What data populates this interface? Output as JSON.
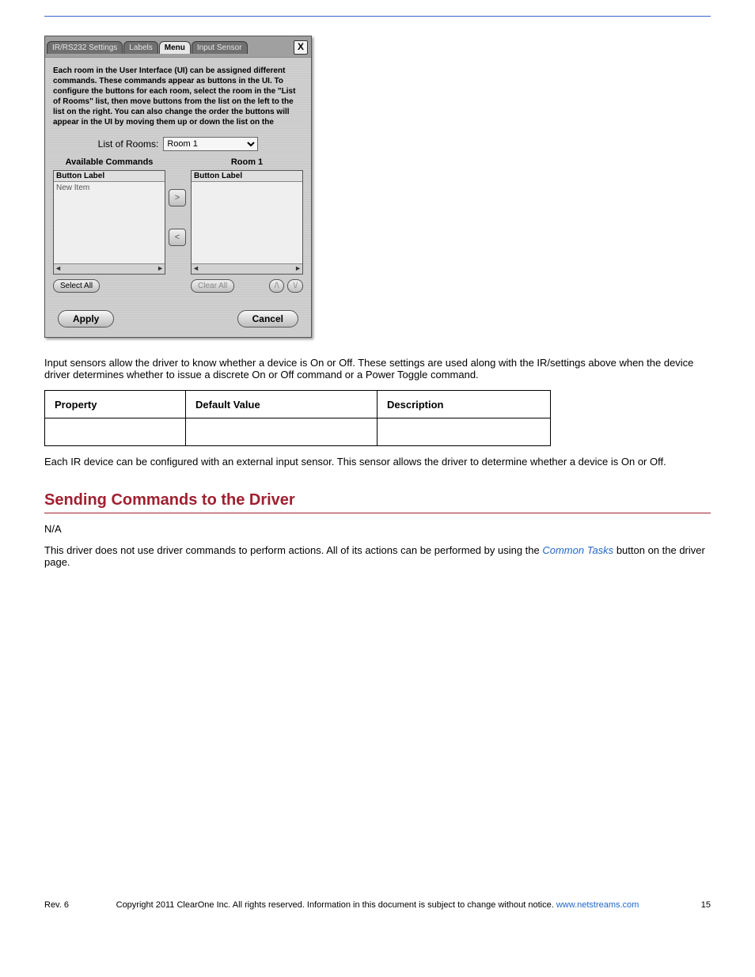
{
  "dialog": {
    "tabs": {
      "ir_rs232": "IR/RS232 Settings",
      "labels": "Labels",
      "menu": "Menu",
      "input_sensor": "Input Sensor"
    },
    "close_x": "X",
    "desc_bold": "Each room in the User Interface (UI) can be assigned different commands.  These commands appear as buttons in the UI.  To configure the buttons for each room, select the room in the \"List of Rooms\" list, then move buttons from the list on the left to the list on the right.  You can also change the order the buttons will appear in the UI by moving them up or down the list on the",
    "rooms_label": "List of Rooms:",
    "rooms_value": "Room 1",
    "avail_hdr": "Available Commands",
    "room_hdr": "Room 1",
    "btn_label_col": "Button Label",
    "sample_item": "New Item",
    "move_right": ">",
    "move_left": "<",
    "select_all": "Select All",
    "clear_all": "Clear All",
    "up": "/\\",
    "down": "\\/",
    "scroll_left": "◄",
    "scroll_right": "►",
    "apply": "Apply",
    "cancel": "Cancel"
  },
  "body": {
    "para_above_spec": "Input sensors allow the driver to know whether a device is On or Off. These settings are used along with the IR/settings above when the device driver determines whether to issue a discrete On or Off command or a Power Toggle command.",
    "spec_th1": "Property",
    "spec_th2": "Default Value",
    "spec_th3": "Description",
    "after_table": "Each IR device can be configured with an external input sensor. This sensor allows the driver to determine whether a device is On or Off.",
    "section_title": "Sending Commands to the Driver",
    "na": "N/A",
    "link_label": "Common Tasks",
    "tail1": "This driver does not use driver commands to perform actions. All of its actions can be performed by using the ",
    "tail2": " button on the ",
    "tail3": " driver page."
  },
  "footer": {
    "left": "Rev. 6",
    "center_pre": "Copyright 2011 ClearOne Inc. All rights reserved. Information in this document is subject to change without notice.",
    "center_link": "www.netstreams.com",
    "right": "15"
  }
}
